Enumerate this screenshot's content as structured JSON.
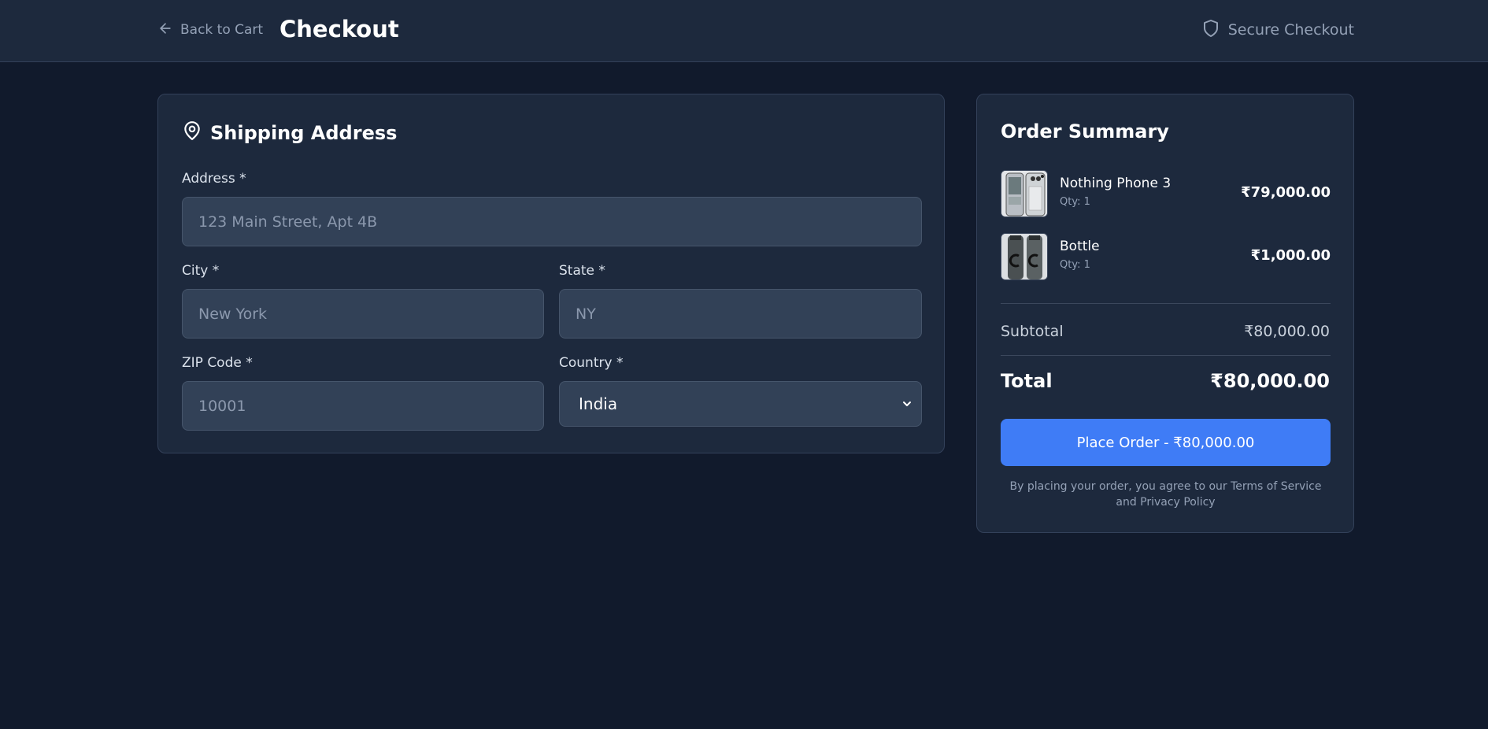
{
  "header": {
    "back_label": "Back to Cart",
    "title": "Checkout",
    "secure_label": "Secure Checkout"
  },
  "shipping": {
    "title": "Shipping Address",
    "fields": {
      "address": {
        "label": "Address *",
        "placeholder": "123 Main Street, Apt 4B",
        "value": ""
      },
      "city": {
        "label": "City *",
        "placeholder": "New York",
        "value": ""
      },
      "state": {
        "label": "State *",
        "placeholder": "NY",
        "value": ""
      },
      "zip": {
        "label": "ZIP Code *",
        "placeholder": "10001",
        "value": ""
      },
      "country": {
        "label": "Country *",
        "selected": "India"
      }
    }
  },
  "summary": {
    "title": "Order Summary",
    "items": [
      {
        "name": "Nothing Phone 3",
        "qty": "Qty: 1",
        "price": "₹79,000.00",
        "thumb_icon": "phone-product-thumbnail"
      },
      {
        "name": "Bottle",
        "qty": "Qty: 1",
        "price": "₹1,000.00",
        "thumb_icon": "bottle-product-thumbnail"
      }
    ],
    "subtotal_label": "Subtotal",
    "subtotal_value": "₹80,000.00",
    "total_label": "Total",
    "total_value": "₹80,000.00",
    "place_order_label": "Place Order - ₹80,000.00",
    "terms": "By placing your order, you agree to our Terms of Service and Privacy Policy"
  },
  "colors": {
    "background": "#111a2c",
    "card": "#1d293d",
    "input": "#324157",
    "accent": "#3f7cf6",
    "muted_text": "#94a1b6"
  }
}
